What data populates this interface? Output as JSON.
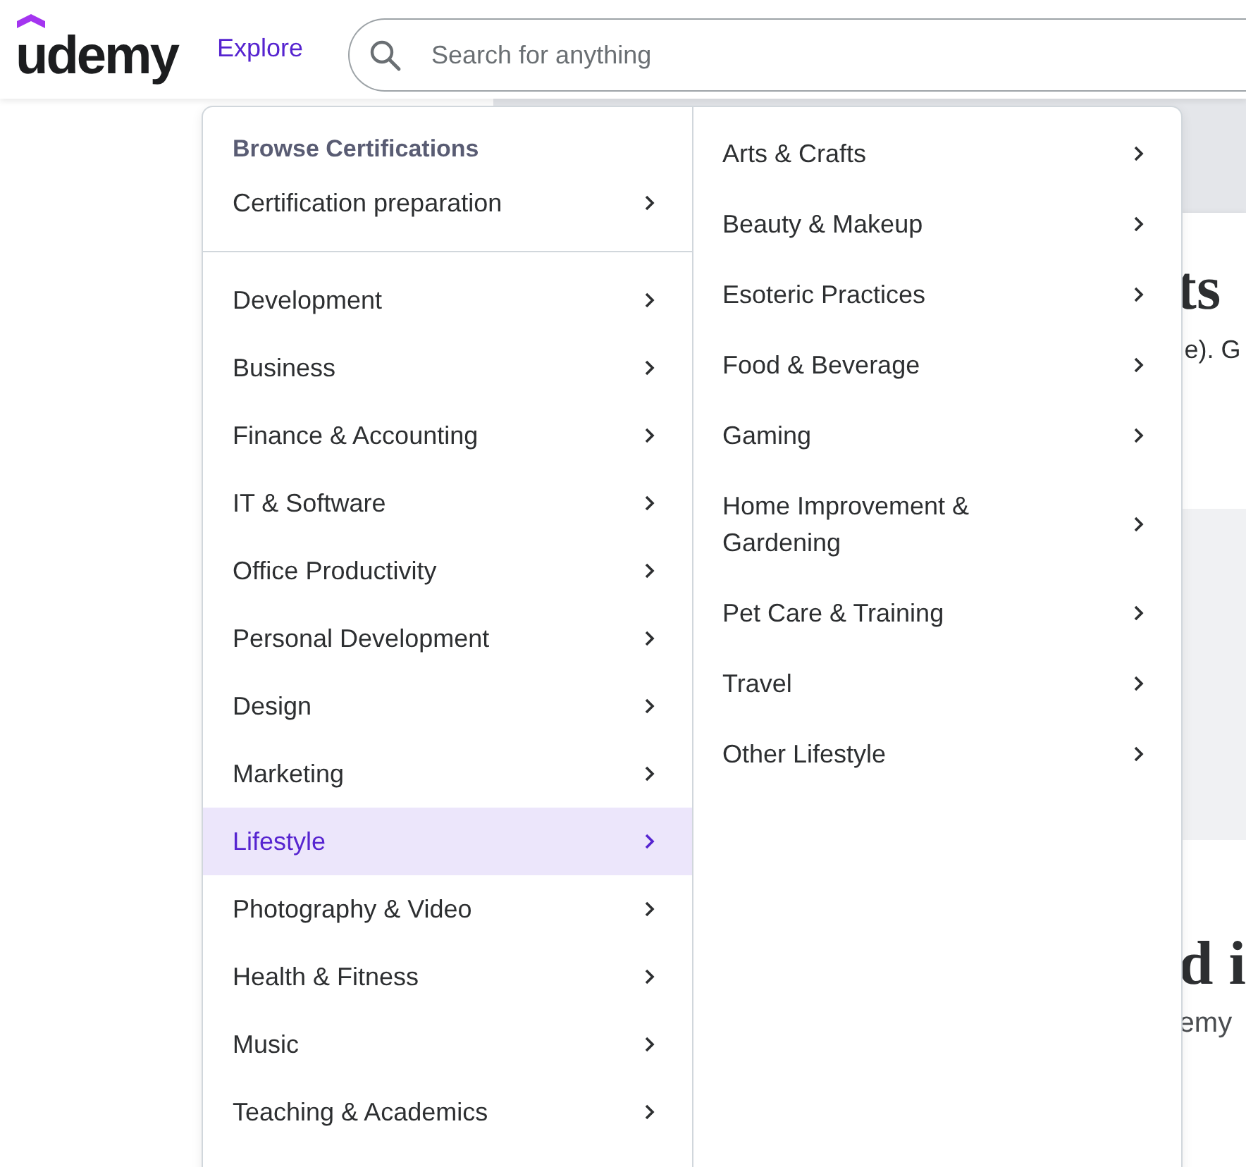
{
  "header": {
    "logo": "udemy",
    "explore": "Explore",
    "search": {
      "placeholder": "Search for anything"
    }
  },
  "background": {
    "heading_1": "ts",
    "text_1": "e). G",
    "heading_2": "d i",
    "text_2": "emy"
  },
  "menu": {
    "section_title": "Browse Certifications",
    "certification_items": [
      {
        "label": "Certification preparation",
        "selected": false
      }
    ],
    "categories": [
      {
        "label": "Development",
        "selected": false
      },
      {
        "label": "Business",
        "selected": false
      },
      {
        "label": "Finance & Accounting",
        "selected": false
      },
      {
        "label": "IT & Software",
        "selected": false
      },
      {
        "label": "Office Productivity",
        "selected": false
      },
      {
        "label": "Personal Development",
        "selected": false
      },
      {
        "label": "Design",
        "selected": false
      },
      {
        "label": "Marketing",
        "selected": false
      },
      {
        "label": "Lifestyle",
        "selected": true
      },
      {
        "label": "Photography & Video",
        "selected": false
      },
      {
        "label": "Health & Fitness",
        "selected": false
      },
      {
        "label": "Music",
        "selected": false
      },
      {
        "label": "Teaching & Academics",
        "selected": false
      }
    ],
    "subcategories": [
      {
        "label": "Arts & Crafts",
        "selected": false
      },
      {
        "label": "Beauty & Makeup",
        "selected": false
      },
      {
        "label": "Esoteric Practices",
        "selected": false
      },
      {
        "label": "Food & Beverage",
        "selected": false
      },
      {
        "label": "Gaming",
        "selected": false
      },
      {
        "label": "Home Improvement & Gardening",
        "selected": false
      },
      {
        "label": "Pet Care & Training",
        "selected": false
      },
      {
        "label": "Travel",
        "selected": false
      },
      {
        "label": "Other Lifestyle",
        "selected": false
      }
    ]
  }
}
